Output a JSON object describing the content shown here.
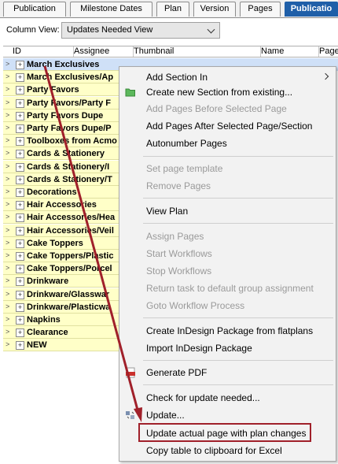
{
  "tabs": [
    {
      "label": "Publication",
      "underline": "P",
      "rest": "ublication",
      "active": false
    },
    {
      "label": "Milestone Dates",
      "underline": "",
      "rest": "Milestone Dates",
      "active": false
    },
    {
      "label": "Plan",
      "underline": "",
      "rest": "Plan",
      "active": false
    },
    {
      "label": "Version",
      "underline": "",
      "rest": "Version",
      "active": false
    },
    {
      "label": "Pages",
      "underline": "P",
      "rest": "ages",
      "active": false
    },
    {
      "label": "Publicatio",
      "underline": "",
      "rest": "Publicatio",
      "active": true
    }
  ],
  "column_view": {
    "label": "Column View:",
    "value": "Updates Needed View"
  },
  "columns": [
    "ID",
    "Assignee",
    "Thumbnail",
    "Name",
    "Page"
  ],
  "sections": [
    "March Exclusives",
    "March Exclusives/Ap",
    "Party Favors",
    "Party Favors/Party F",
    "Party Favors Dupe",
    "Party Favors Dupe/P",
    "Toolboxes from Acmo",
    "Cards & Stationery",
    "Cards & Stationery/I",
    "Cards & Stationery/T",
    "Decorations",
    "Hair Accessories",
    "Hair Accessories/Hea",
    "Hair Accessories/Veil",
    "Cake Toppers",
    "Cake Toppers/Plastic",
    "Cake Toppers/Porcel",
    "Drinkware",
    "Drinkware/Glasswar",
    "Drinkware/Plasticwa",
    "Napkins",
    "Clearance",
    "NEW"
  ],
  "menu": {
    "add_section_in": "Add Section In",
    "create_new_section": "Create new Section from existing...",
    "add_pages_before": "Add Pages Before Selected Page",
    "add_pages_after": "Add Pages After Selected Page/Section",
    "autonumber_pages": "Autonumber Pages",
    "set_page_template": "Set page template",
    "remove_pages": "Remove Pages",
    "view_plan": "View Plan",
    "assign_pages": "Assign Pages",
    "start_workflows": "Start Workflows",
    "stop_workflows": "Stop Workflows",
    "return_task": "Return task to default group assignment",
    "goto_workflow": "Goto Workflow Process",
    "create_indesign_package": "Create InDesign Package from flatplans",
    "import_indesign_package": "Import InDesign Package",
    "generate_pdf": "Generate PDF",
    "check_for_update": "Check for update needed...",
    "update": "Update...",
    "update_actual_page": "Update actual page with plan changes",
    "copy_table": "Copy table to clipboard for Excel"
  },
  "colors": {
    "accent": "#1f5fa8",
    "annotation": "#a0202a",
    "row_bg": "#ffffc8"
  }
}
